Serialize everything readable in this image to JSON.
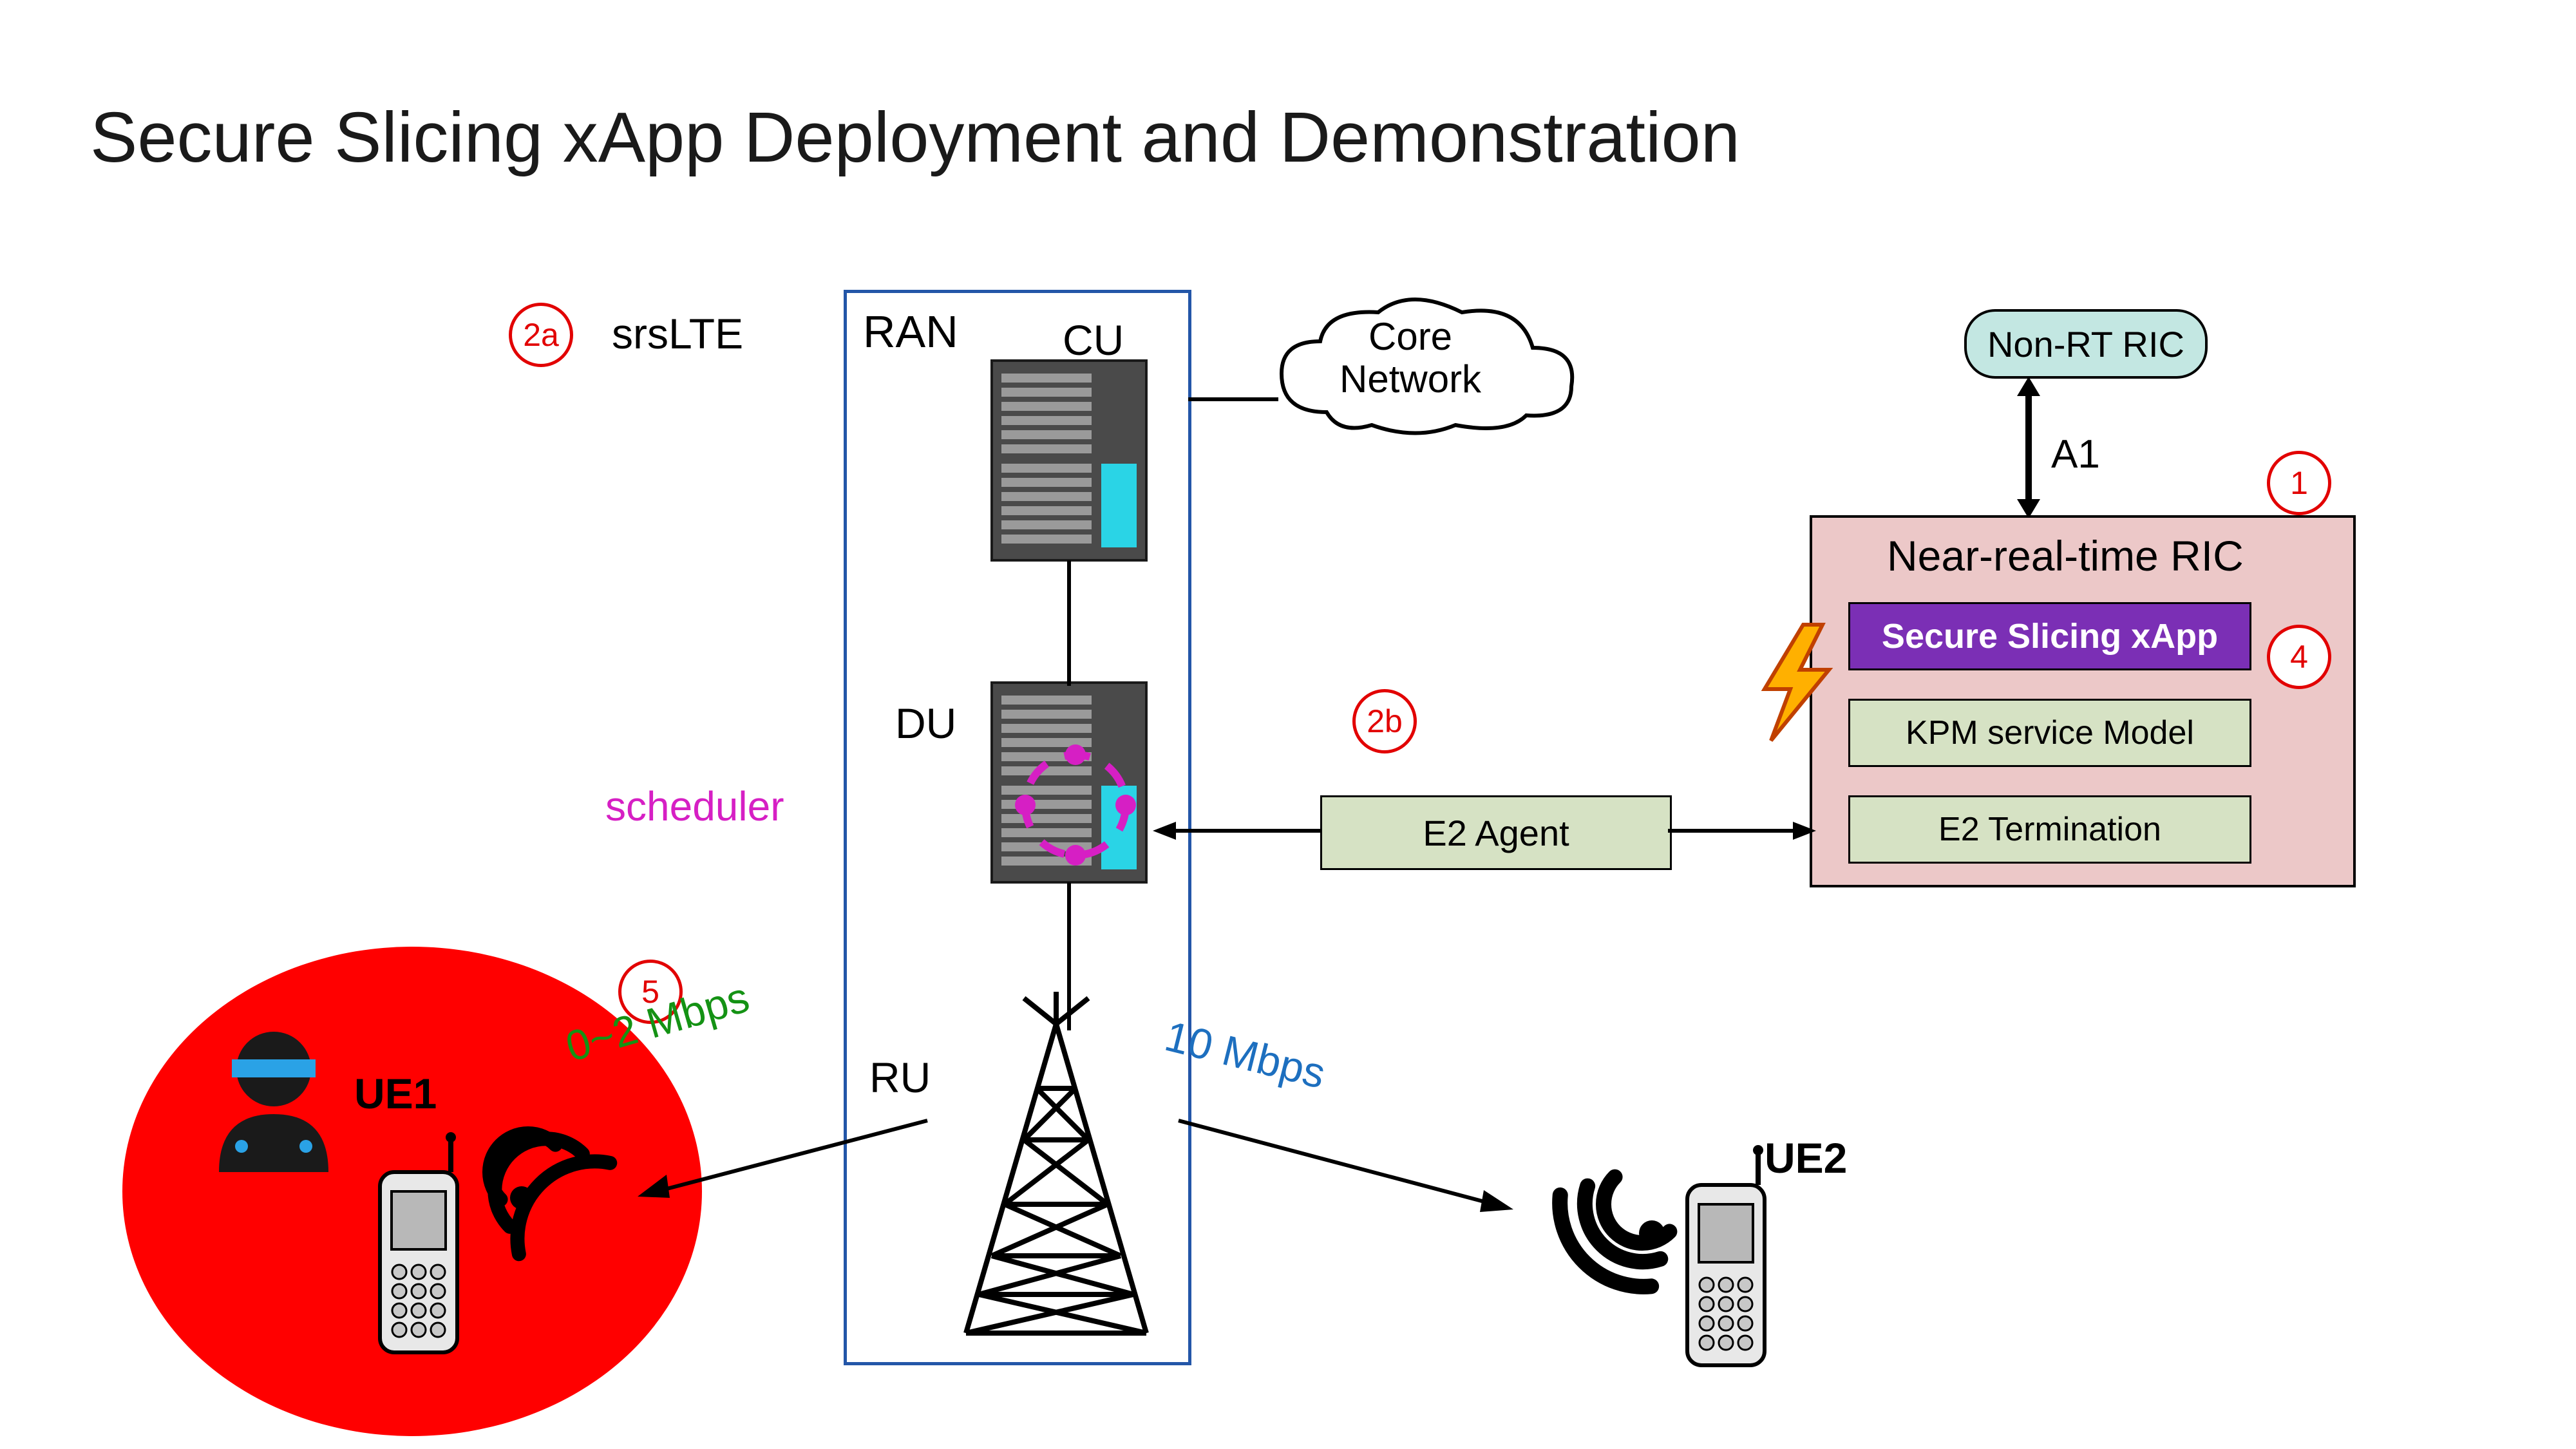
{
  "title": "Secure Slicing xApp Deployment and Demonstration",
  "labels": {
    "ran": "RAN",
    "cu": "CU",
    "du": "DU",
    "ru": "RU",
    "scheduler": "scheduler",
    "srslte": "srsLTE",
    "core_line1": "Core",
    "core_line2": "Network",
    "a1": "A1",
    "ue1": "UE1",
    "ue2": "UE2",
    "ue1_rate": "0~2 Mbps",
    "ue2_rate": "10 Mbps"
  },
  "ric": {
    "nonrt": "Non-RT RIC",
    "near_rt_title": "Near-real-time RIC",
    "xapp": "Secure Slicing xApp",
    "kpm": "KPM service Model",
    "e2term": "E2 Termination",
    "e2agent": "E2 Agent"
  },
  "callouts": {
    "c1": "1",
    "c2a": "2a",
    "c2b": "2b",
    "c4": "4",
    "c5": "5"
  },
  "colors": {
    "accent_purple": "#7b2fb5",
    "accent_red": "#ff0000",
    "accent_green": "#d6e2c4",
    "accent_pink": "#ecc8c8",
    "accent_teal": "#c3e7e2"
  }
}
